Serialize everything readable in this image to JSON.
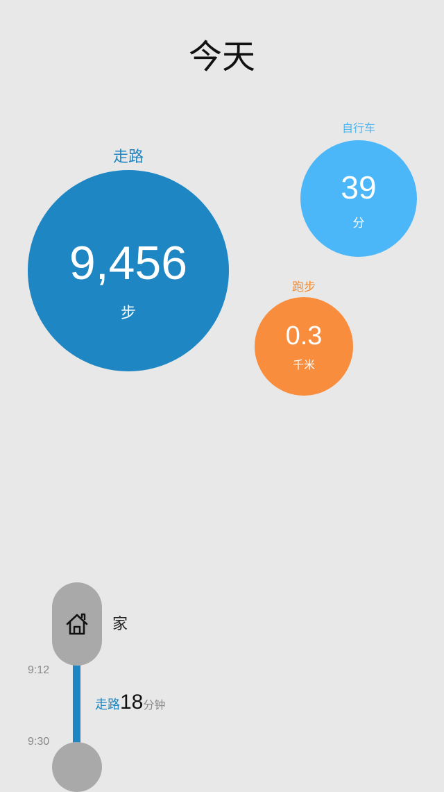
{
  "header": {
    "title": "今天"
  },
  "activities": {
    "walking": {
      "label": "走路",
      "value": "9,456",
      "unit": "步",
      "color": "#1e86c2"
    },
    "cycling": {
      "label": "自行车",
      "value": "39",
      "unit": "分",
      "color": "#4bb7f8"
    },
    "running": {
      "label": "跑步",
      "value": "0.3",
      "unit": "千米",
      "color": "#f88d3d"
    }
  },
  "timeline": {
    "place": {
      "name": "家",
      "icon": "home-icon"
    },
    "start_time": "9:12",
    "end_time": "9:30",
    "segment": {
      "activity": "走路",
      "duration": "18",
      "duration_unit": "分钟"
    },
    "line_color": "#1e86c2"
  }
}
